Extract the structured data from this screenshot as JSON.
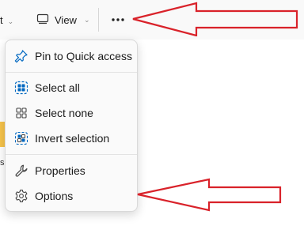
{
  "toolbar": {
    "partial_label": "t",
    "view_label": "View",
    "more_label": "See more"
  },
  "menu": {
    "items": [
      {
        "label": "Pin to Quick access",
        "icon": "pin-icon"
      },
      {
        "label": "Select all",
        "icon": "select-all-icon"
      },
      {
        "label": "Select none",
        "icon": "select-none-icon"
      },
      {
        "label": "Invert selection",
        "icon": "invert-selection-icon"
      },
      {
        "label": "Properties",
        "icon": "wrench-icon"
      },
      {
        "label": "Options",
        "icon": "gear-icon"
      }
    ]
  },
  "background": {
    "partial_text": "s"
  },
  "annotations": {
    "arrow_color": "#d9222a"
  },
  "colors": {
    "accent": "#0067c0",
    "folder": "#f6c34a"
  }
}
